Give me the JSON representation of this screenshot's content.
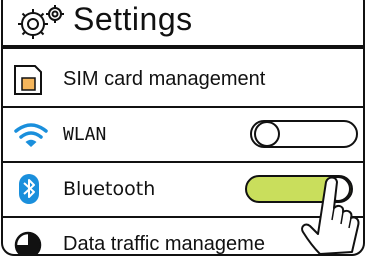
{
  "header": {
    "title": "Settings",
    "icon": "gear-icon"
  },
  "items": [
    {
      "label": "SIM card management",
      "icon": "sim-card-icon"
    },
    {
      "label": "WLAN",
      "icon": "wifi-icon",
      "toggle_on": false
    },
    {
      "label": "Bluetooth",
      "icon": "bluetooth-icon",
      "toggle_on": true
    },
    {
      "label": "Data traffic manageme",
      "icon": "pie-chart-icon"
    }
  ],
  "colors": {
    "toggle_on": "#c9de5c",
    "toggle_off": "#ffffff",
    "sim_fill": "#f5b65c",
    "bluetooth": "#1a8fdc",
    "wifi": "#1a8fdc"
  }
}
